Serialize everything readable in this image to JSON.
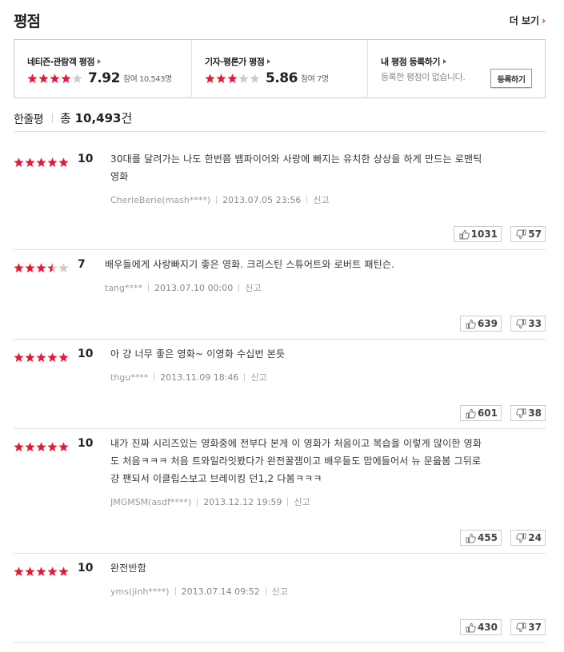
{
  "header": {
    "title": "평점",
    "more_label": "더 보기",
    "more_arrow": "›"
  },
  "summary": {
    "netizen": {
      "label": "네티즌·관람객 평점",
      "score": "7.92",
      "participants": "참여 10,543명",
      "stars": 4
    },
    "critic": {
      "label": "기자·평론가 평점",
      "score": "5.86",
      "participants": "참여 7명",
      "stars": 3
    },
    "mine": {
      "label": "내 평점 등록하기",
      "empty_message": "등록한 평점이 없습니다.",
      "register_button": "등록하기"
    }
  },
  "one_line": {
    "label": "한줄평",
    "total_prefix": "총",
    "total": "10,493",
    "total_suffix": "건"
  },
  "colors": {
    "accent": "#e51937",
    "star_off": "#cccccc"
  },
  "reviews": [
    {
      "stars": 5,
      "score": "10",
      "text_lines": [
        "30대를 달려가는 나도 한번쯤 뱀파이어와 사랑에 빠지는 유치한 상상을 하게 만드는 로맨틱",
        "영화"
      ],
      "author": "CherieBerie(mash****)",
      "date": "2013.07.05 23:56",
      "report": "신고",
      "likes": "1031",
      "dislikes": "57"
    },
    {
      "stars": 3.5,
      "score": "7",
      "text_lines": [
        "배우들에게 사랑빠지기 좋은 영화. 크리스틴 스튜어트와 로버트 패틴슨."
      ],
      "author": "tang****",
      "date": "2013.07.10 00:00",
      "report": "신고",
      "likes": "639",
      "dislikes": "33"
    },
    {
      "stars": 5,
      "score": "10",
      "text_lines": [
        "아 걍 너무 좋은 영화~ 이영화 수십번 본듯"
      ],
      "author": "thgu****",
      "date": "2013.11.09 18:46",
      "report": "신고",
      "likes": "601",
      "dislikes": "38"
    },
    {
      "stars": 5,
      "score": "10",
      "text_lines": [
        "내가 진짜 시리즈있는 영화중에 전부다 본게 이 영화가 처음이고 복습을 이렇게 많이한 영화",
        "도 처음ㅋㅋㅋ 처음 트와일라잇봤다가 완전꿀잼이고 배우들도 맘에들어서 뉴 문읊봄 그뒤로",
        "걍 팬되서 이클립스보고 브레이킹 던1,2 다봄ㅋㅋㅋ"
      ],
      "author": "JMGMSM(asdf****)",
      "date": "2013.12.12 19:59",
      "report": "신고",
      "likes": "455",
      "dislikes": "24"
    },
    {
      "stars": 5,
      "score": "10",
      "text_lines": [
        "완전반함"
      ],
      "author": "yms(jinh****)",
      "date": "2013.07.14 09:52",
      "report": "신고",
      "likes": "430",
      "dislikes": "37"
    }
  ]
}
